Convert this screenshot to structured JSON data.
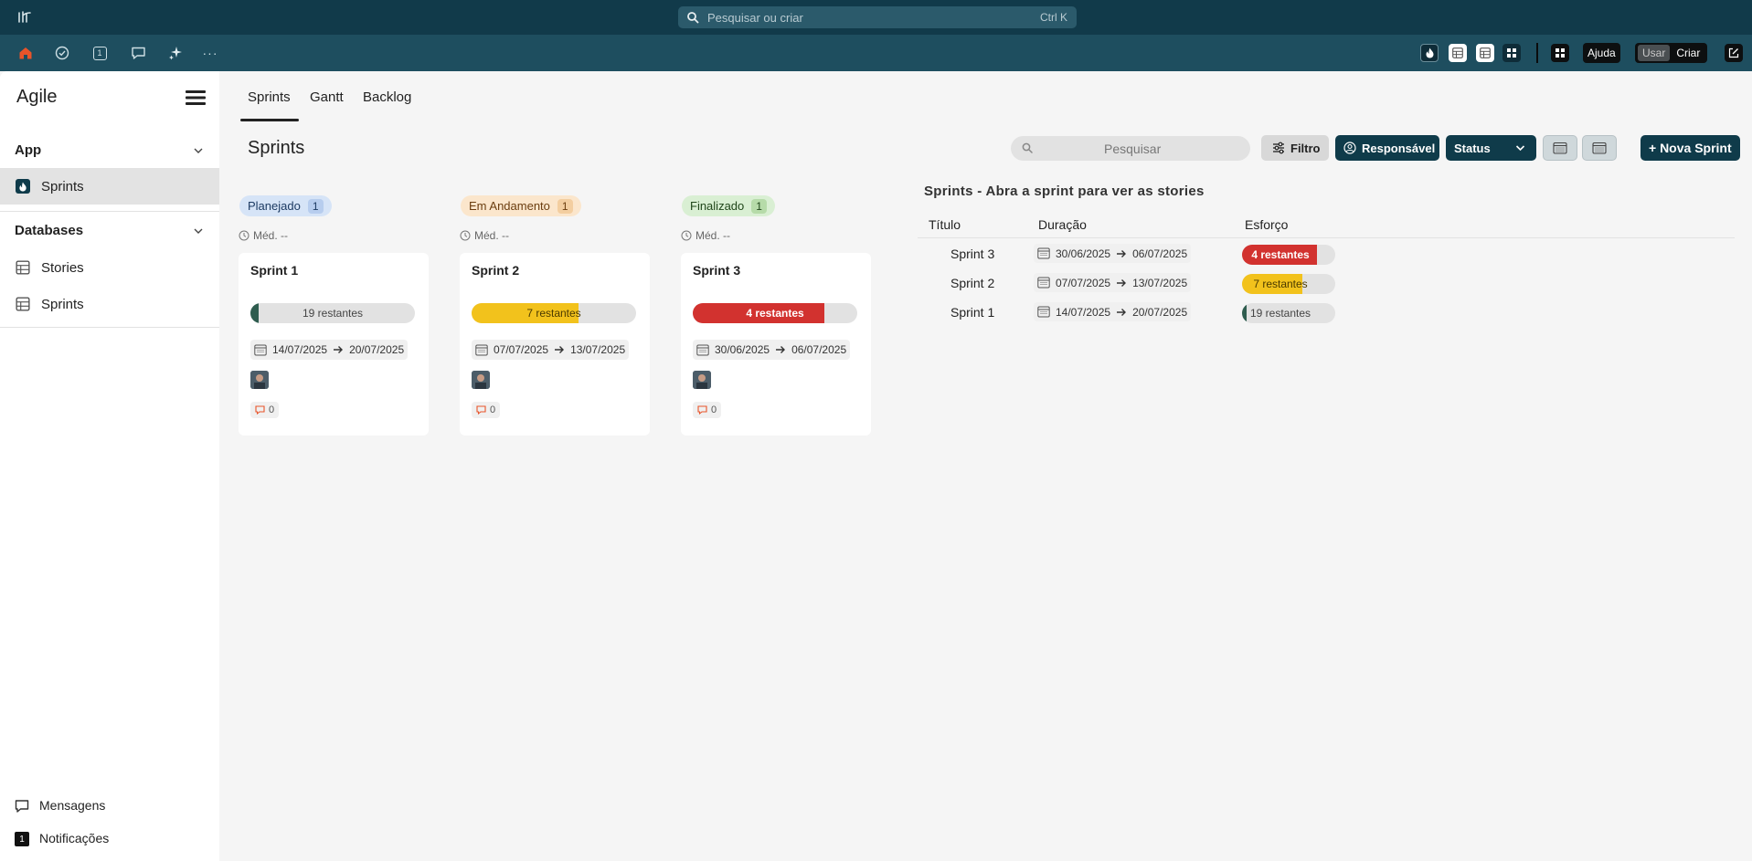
{
  "topbar": {
    "search_placeholder": "Pesquisar ou criar",
    "search_shortcut": "Ctrl K"
  },
  "appbar": {
    "notification_count": "1",
    "help_label": "Ajuda",
    "mode_use": "Usar",
    "mode_create": "Criar",
    "accent_color": "#e8542a"
  },
  "sidebar": {
    "title": "Agile",
    "app_section": "App",
    "app_items": [
      {
        "label": "Sprints",
        "icon": "flame-icon"
      }
    ],
    "databases_section": "Databases",
    "database_items": [
      {
        "label": "Stories",
        "icon": "table-icon"
      },
      {
        "label": "Sprints",
        "icon": "table-icon"
      }
    ],
    "bottom": {
      "messages": "Mensagens",
      "notifications": "Notificações",
      "notifications_count": "1"
    }
  },
  "tabs": [
    "Sprints",
    "Gantt",
    "Backlog"
  ],
  "page_title": "Sprints",
  "toolbar": {
    "search_placeholder": "Pesquisar",
    "filter_label": "Filtro",
    "owner_label": "Responsável",
    "status_label": "Status",
    "new_sprint_label": "+ Nova Sprint"
  },
  "board": {
    "columns": [
      {
        "name": "Planejado",
        "count": "1",
        "avg": "Méd. --",
        "badge_bg": "#d6e4f7",
        "badge_fg": "#1d3b63",
        "count_bg": "#b7cdee",
        "card": {
          "title": "Sprint 1",
          "remaining": "19 restantes",
          "progress": 0.05,
          "bar_color": "#2f5d4f",
          "text_color": "#444",
          "start": "14/07/2025",
          "end": "20/07/2025",
          "comments": "0"
        }
      },
      {
        "name": "Em Andamento",
        "count": "1",
        "avg": "Méd. --",
        "badge_bg": "#fbe6cc",
        "badge_fg": "#6b3d0f",
        "count_bg": "#f3cea0",
        "card": {
          "title": "Sprint 2",
          "remaining": "7 restantes",
          "progress": 0.65,
          "bar_color": "#f2c21c",
          "text_color": "#4a3a00",
          "start": "07/07/2025",
          "end": "13/07/2025",
          "comments": "0"
        }
      },
      {
        "name": "Finalizado",
        "count": "1",
        "avg": "Méd. --",
        "badge_bg": "#d9efd3",
        "badge_fg": "#20461a",
        "count_bg": "#b6dba9",
        "card": {
          "title": "Sprint 3",
          "remaining": "4 restantes",
          "progress": 0.8,
          "bar_color": "#d2322f",
          "text_color": "#ffffff",
          "start": "30/06/2025",
          "end": "06/07/2025",
          "comments": "0"
        }
      }
    ]
  },
  "table": {
    "title": "Sprints - Abra a sprint para ver as stories",
    "headers": [
      "Título",
      "Duração",
      "Esforço"
    ],
    "rows": [
      {
        "title": "Sprint 3",
        "start": "30/06/2025",
        "end": "06/07/2025",
        "remaining": "4 restantes",
        "progress": 0.8,
        "bar_color": "#d2322f",
        "text_color": "#ffffff"
      },
      {
        "title": "Sprint 2",
        "start": "07/07/2025",
        "end": "13/07/2025",
        "remaining": "7 restantes",
        "progress": 0.65,
        "bar_color": "#f2c21c",
        "text_color": "#4a3a00"
      },
      {
        "title": "Sprint 1",
        "start": "14/07/2025",
        "end": "20/07/2025",
        "remaining": "19 restantes",
        "progress": 0.05,
        "bar_color": "#2f5d4f",
        "text_color": "#444"
      }
    ]
  }
}
